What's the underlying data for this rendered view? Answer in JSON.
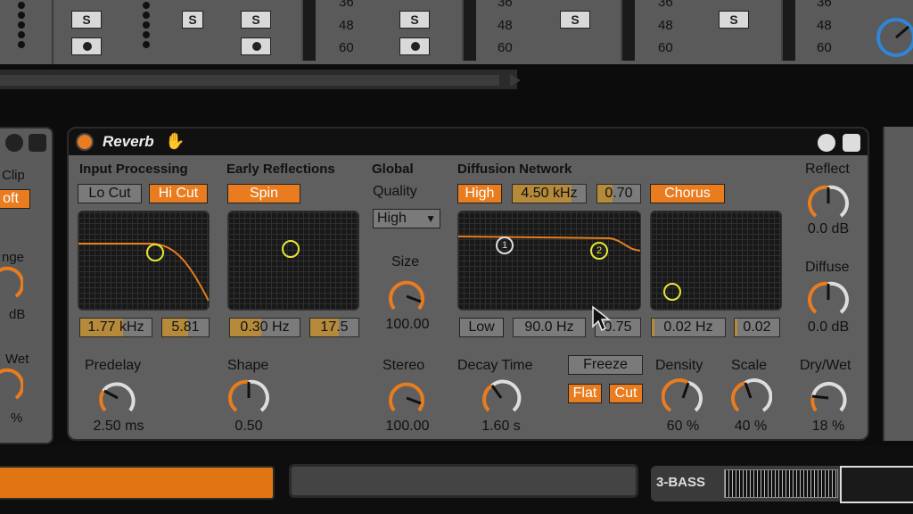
{
  "mixer": {
    "solo_label": "S",
    "db_ticks": [
      "36",
      "48",
      "60"
    ]
  },
  "left_device": {
    "clip_label": "Clip",
    "clip_value": "oft",
    "range_label": "nge",
    "range_value": "dB",
    "drywet_label": "Wet",
    "drywet_value": "%"
  },
  "reverb": {
    "title": "Reverb",
    "sections": {
      "input": "Input Processing",
      "early": "Early Reflections",
      "global": "Global",
      "diffusion": "Diffusion Network"
    },
    "buttons": {
      "lo_cut": "Lo Cut",
      "hi_cut": "Hi Cut",
      "spin": "Spin",
      "high": "High",
      "chorus": "Chorus",
      "freeze": "Freeze",
      "flat": "Flat",
      "cut": "Cut",
      "low": "Low"
    },
    "fields": {
      "input_freq": "1.77 kHz",
      "input_q": "5.81",
      "early_freq": "0.30 Hz",
      "early_amt": "17.5",
      "diff_high_freq": "4.50 kHz",
      "diff_high_amt": "0.70",
      "diff_low_freq": "90.0 Hz",
      "diff_low_amt": "0.75",
      "chorus_freq": "0.02 Hz",
      "chorus_amt": "0.02"
    },
    "quality_label": "Quality",
    "quality_value": "High",
    "knobs": {
      "size": {
        "label": "Size",
        "value": "100.00",
        "level": 1.0
      },
      "predelay": {
        "label": "Predelay",
        "value": "2.50 ms",
        "level": 0.3
      },
      "shape": {
        "label": "Shape",
        "value": "0.50",
        "level": 0.5
      },
      "stereo": {
        "label": "Stereo",
        "value": "100.00",
        "level": 1.0
      },
      "decay": {
        "label": "Decay Time",
        "value": "1.60 s",
        "level": 0.35
      },
      "density": {
        "label": "Density",
        "value": "60 %",
        "level": 0.6
      },
      "scale": {
        "label": "Scale",
        "value": "40 %",
        "level": 0.4
      },
      "drywet": {
        "label": "Dry/Wet",
        "value": "18 %",
        "level": 0.18
      },
      "reflect": {
        "label": "Reflect",
        "value": "0.0 dB",
        "level": 0.5
      },
      "diffuse": {
        "label": "Diffuse",
        "value": "0.0 dB",
        "level": 0.5
      }
    },
    "diffusion_markers": [
      "1",
      "2"
    ]
  },
  "bottom": {
    "track_name": "3-BASS"
  },
  "colors": {
    "accent": "#e87c1e",
    "dot": "#e6e633",
    "panel": "#5f5f5f"
  }
}
